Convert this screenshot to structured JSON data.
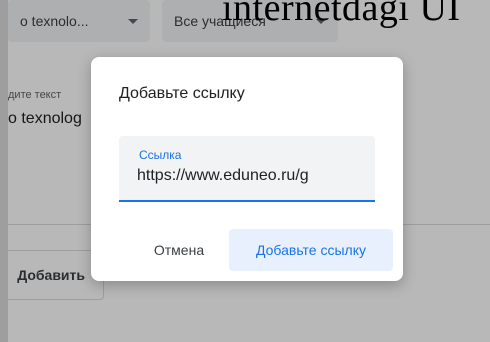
{
  "background": {
    "top_title_fragment": "internetdagi UI",
    "filters": [
      {
        "label": "о texnolo..."
      },
      {
        "label": "Все учащиеся"
      }
    ],
    "text_field_label": "дите текст",
    "text_field_value": "o texnolog",
    "add_button_label": "Добавить"
  },
  "dialog": {
    "title": "Добавьте ссылку",
    "field_label": "Ссылка",
    "field_value": "https://www.eduneo.ru/g",
    "cancel_label": "Отмена",
    "confirm_label": "Добавьте ссылку"
  },
  "colors": {
    "accent": "#1a73e8",
    "accent_bg": "#e8f0fe",
    "field_bg": "#f1f3f4"
  }
}
